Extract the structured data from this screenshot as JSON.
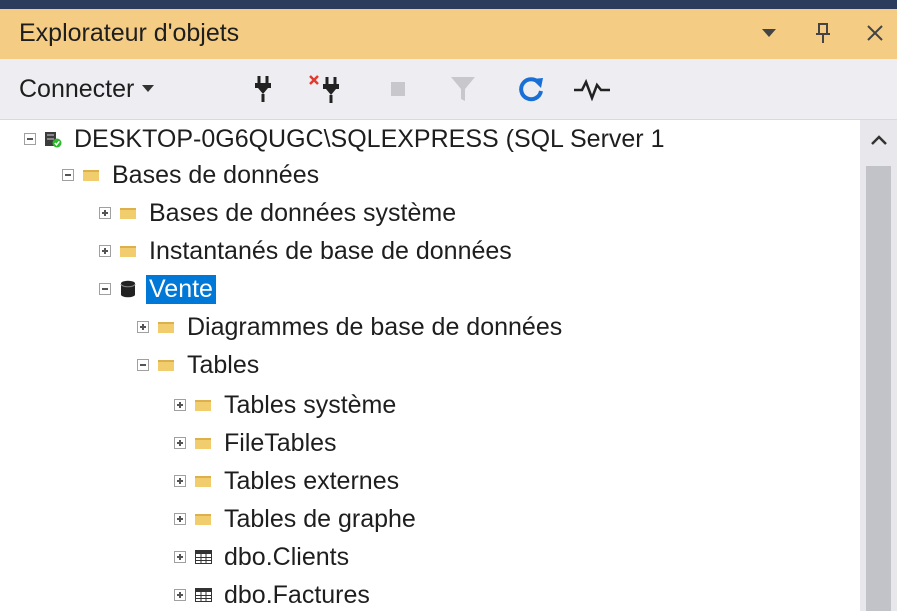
{
  "window": {
    "title": "Explorateur d'objets",
    "dropdown_icon": "chevron-down-icon",
    "pin_icon": "pin-icon",
    "close_icon": "close-icon"
  },
  "toolbar": {
    "connect_label": "Connecter",
    "buttons": [
      {
        "name": "connect-icon"
      },
      {
        "name": "disconnect-icon"
      },
      {
        "name": "stop-icon"
      },
      {
        "name": "filter-icon"
      },
      {
        "name": "refresh-icon"
      },
      {
        "name": "activity-monitor-icon"
      }
    ]
  },
  "tree": {
    "items": [
      {
        "label": "DESKTOP-0G6QUGC\\SQLEXPRESS (SQL Server 1",
        "icon": "server-icon",
        "expanded": true
      },
      {
        "label": "Bases de données",
        "icon": "folder-icon",
        "expanded": true
      },
      {
        "label": "Bases de données système",
        "icon": "folder-icon",
        "expanded": false
      },
      {
        "label": "Instantanés de base de données",
        "icon": "folder-icon",
        "expanded": false
      },
      {
        "label": "Vente",
        "icon": "database-icon",
        "expanded": true,
        "selected": true
      },
      {
        "label": "Diagrammes de base de données",
        "icon": "folder-icon",
        "expanded": false
      },
      {
        "label": "Tables",
        "icon": "folder-icon",
        "expanded": true
      },
      {
        "label": "Tables système",
        "icon": "folder-icon",
        "expanded": false
      },
      {
        "label": "FileTables",
        "icon": "folder-icon",
        "expanded": false
      },
      {
        "label": "Tables externes",
        "icon": "folder-icon",
        "expanded": false
      },
      {
        "label": "Tables de graphe",
        "icon": "folder-icon",
        "expanded": false
      },
      {
        "label": "dbo.Clients",
        "icon": "table-icon",
        "expanded": false
      },
      {
        "label": "dbo.Factures",
        "icon": "table-icon",
        "expanded": false
      }
    ]
  },
  "colors": {
    "title_bar": "#f5cc84",
    "toolbar": "#eeeef2",
    "selection": "#0078d7",
    "folder": "#f2cd6e"
  }
}
